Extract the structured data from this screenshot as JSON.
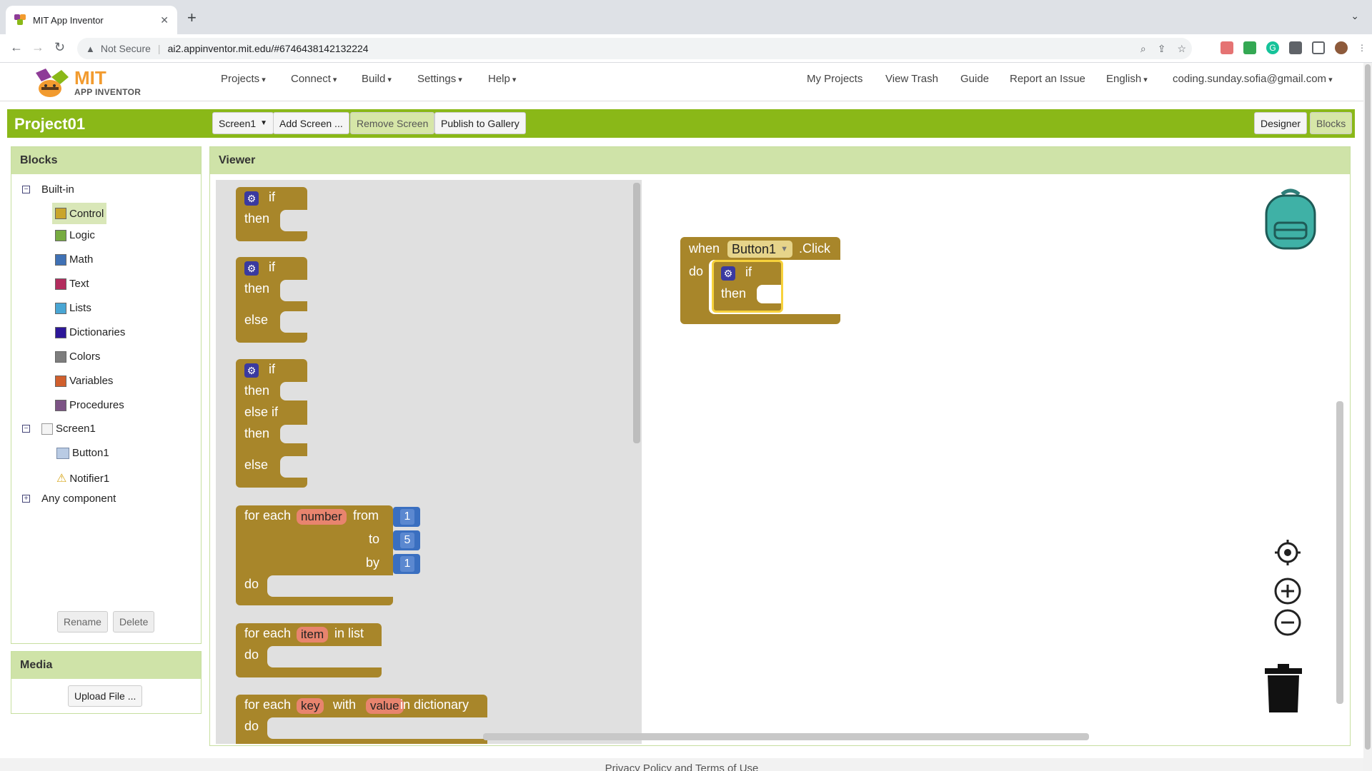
{
  "browser": {
    "tab_title": "MIT App Inventor",
    "not_secure": "Not Secure",
    "url": "ai2.appinventor.mit.edu/#6746438142132224"
  },
  "app": {
    "logo_mit": "MIT",
    "logo_sub": "APP INVENTOR",
    "menus": [
      "Projects",
      "Connect",
      "Build",
      "Settings",
      "Help"
    ],
    "right_menu": {
      "my_projects": "My Projects",
      "view_trash": "View Trash",
      "guide": "Guide",
      "report": "Report an Issue",
      "language": "English",
      "account": "coding.sunday.sofia@gmail.com"
    }
  },
  "project": {
    "name": "Project01",
    "screen_select": "Screen1",
    "add_screen": "Add Screen ...",
    "remove_screen": "Remove Screen",
    "publish": "Publish to Gallery",
    "designer": "Designer",
    "blocks": "Blocks"
  },
  "blocks_panel": {
    "title": "Blocks",
    "builtin": "Built-in",
    "categories": [
      {
        "label": "Control",
        "color": "#c9a52b"
      },
      {
        "label": "Logic",
        "color": "#77ab41"
      },
      {
        "label": "Math",
        "color": "#3f71b5"
      },
      {
        "label": "Text",
        "color": "#b32d5e"
      },
      {
        "label": "Lists",
        "color": "#49a6d4"
      },
      {
        "label": "Dictionaries",
        "color": "#2d1799"
      },
      {
        "label": "Colors",
        "color": "#7d7d7d"
      },
      {
        "label": "Variables",
        "color": "#d05f2d"
      },
      {
        "label": "Procedures",
        "color": "#7c5385"
      }
    ],
    "screen": "Screen1",
    "components": [
      "Button1",
      "Notifier1"
    ],
    "any_component": "Any component",
    "rename": "Rename",
    "delete": "Delete"
  },
  "media_panel": {
    "title": "Media",
    "upload": "Upload File ..."
  },
  "viewer": {
    "title": "Viewer",
    "flyout": {
      "if": "if",
      "then": "then",
      "else": "else",
      "else_if": "else if",
      "for_each": "for each",
      "number_var": "number",
      "from": "from",
      "to": "to",
      "by": "by",
      "do": "do",
      "from_val": "1",
      "to_val": "5",
      "by_val": "1",
      "item_var": "item",
      "in_list": "in list",
      "key_var": "key",
      "with": "with",
      "value_var": "value",
      "in_dictionary": "in dictionary"
    },
    "event": {
      "when": "when",
      "component": "Button1",
      "event": ".Click",
      "do": "do",
      "if": "if",
      "then": "then"
    }
  },
  "footer": "Privacy Policy and Terms of Use"
}
